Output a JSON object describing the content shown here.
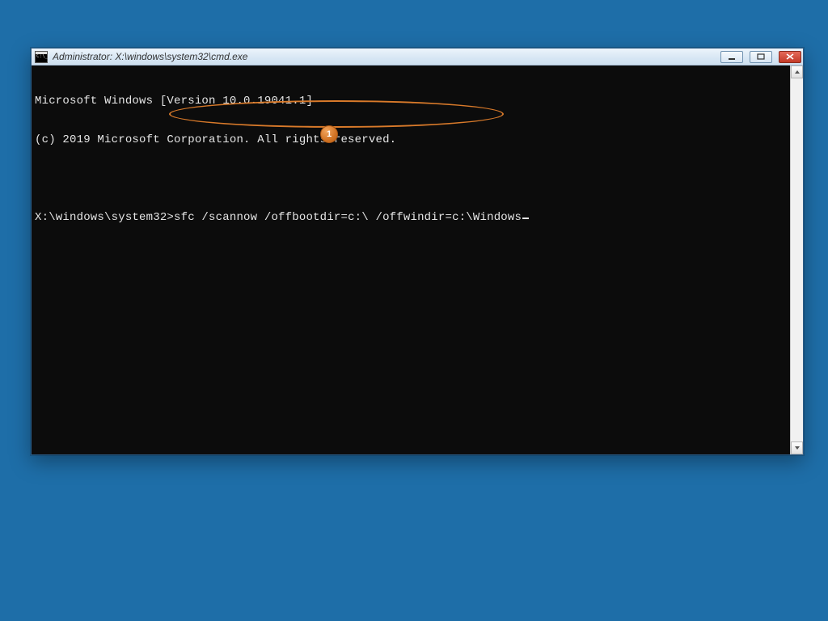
{
  "window": {
    "title": "Administrator: X:\\windows\\system32\\cmd.exe"
  },
  "terminal": {
    "banner_line1": "Microsoft Windows [Version 10.0.19041.1]",
    "banner_line2": "(c) 2019 Microsoft Corporation. All rights reserved.",
    "prompt": "X:\\windows\\system32>",
    "command": "sfc /scannow /offbootdir=c:\\ /offwindir=c:\\Windows"
  },
  "annotation": {
    "badge_number": "1"
  },
  "icons": {
    "minimize": "minimize-icon",
    "maximize": "maximize-icon",
    "close": "close-icon",
    "scroll_up": "chevron-up-icon",
    "scroll_down": "chevron-down-icon",
    "app": "cmd-app-icon"
  }
}
